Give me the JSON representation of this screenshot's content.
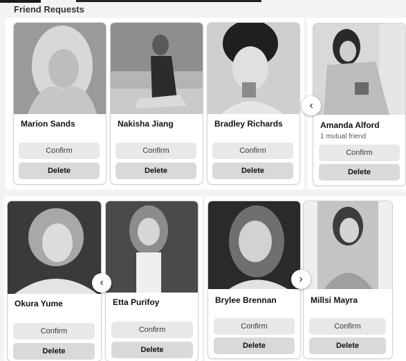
{
  "section": {
    "title": "Friend Requests"
  },
  "buttons": {
    "confirm": "Confirm",
    "delete": "Delete"
  },
  "nav": {
    "prev_glyph": "‹",
    "next_glyph": "›"
  },
  "row1": [
    {
      "name": "Marion Sands",
      "mutual": ""
    },
    {
      "name": "Nakisha Jiang",
      "mutual": ""
    },
    {
      "name": "Bradley Richards",
      "mutual": ""
    },
    {
      "name": "Amanda Alford",
      "mutual": "1 mutual friend"
    }
  ],
  "row2": [
    {
      "name": "Okura Yume",
      "mutual": ""
    },
    {
      "name": "Etta Purifoy",
      "mutual": ""
    },
    {
      "name": "Brylee Brennan",
      "mutual": ""
    },
    {
      "name": "Millsi Mayra",
      "mutual": ""
    }
  ]
}
